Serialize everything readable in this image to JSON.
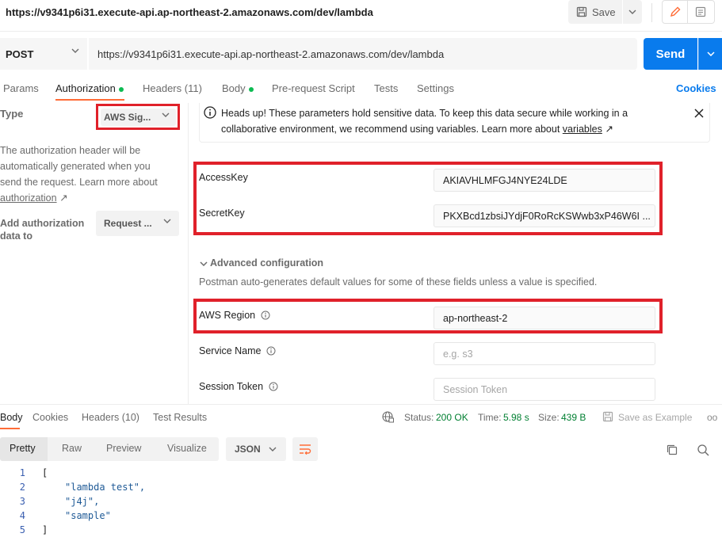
{
  "window": {
    "title": "https://v9341p6i31.execute-api.ap-northeast-2.amazonaws.com/dev/lambda"
  },
  "toolbar": {
    "save_label": "Save"
  },
  "request": {
    "method": "POST",
    "url": "https://v9341p6i31.execute-api.ap-northeast-2.amazonaws.com/dev/lambda",
    "send_label": "Send"
  },
  "tabs": [
    {
      "label": "Params"
    },
    {
      "label": "Authorization"
    },
    {
      "label": "Headers (11)"
    },
    {
      "label": "Body"
    },
    {
      "label": "Pre-request Script"
    },
    {
      "label": "Tests"
    },
    {
      "label": "Settings"
    }
  ],
  "cookies_label": "Cookies",
  "auth": {
    "type_label": "Type",
    "type_value": "AWS Sig...",
    "description": "The authorization header will be automatically generated when you send the request. Learn more about",
    "description_link": "authorization",
    "add_label": "Add authorization data to",
    "add_value": "Request ..."
  },
  "banner": {
    "text": "Heads up! These parameters hold sensitive data. To keep this data secure while working in a collaborative environment, we recommend using variables. Learn more about",
    "link": "variables"
  },
  "fields": {
    "access_key_label": "AccessKey",
    "access_key_value": "AKIAVHLMFGJ4NYE24LDE",
    "secret_key_label": "SecretKey",
    "secret_key_value": "PKXBcd1zbsiJYdjF0RoRcKSWwb3xP46W6I ...",
    "advanced_title": "Advanced configuration",
    "advanced_desc": "Postman auto-generates default values for some of these fields unless a value is specified.",
    "region_label": "AWS Region",
    "region_value": "ap-northeast-2",
    "service_label": "Service Name",
    "service_placeholder": "e.g. s3",
    "session_label": "Session Token",
    "session_placeholder": "Session Token"
  },
  "response": {
    "tabs": [
      {
        "label": "Body"
      },
      {
        "label": "Cookies"
      },
      {
        "label": "Headers (10)"
      },
      {
        "label": "Test Results"
      }
    ],
    "status_label": "Status:",
    "status_value": "200 OK",
    "time_label": "Time:",
    "time_value": "5.98 s",
    "size_label": "Size:",
    "size_value": "439 B",
    "save_example": "Save as Example",
    "more": "oo",
    "view_tabs": [
      {
        "label": "Pretty"
      },
      {
        "label": "Raw"
      },
      {
        "label": "Preview"
      },
      {
        "label": "Visualize"
      }
    ],
    "format": "JSON",
    "code_lines": [
      {
        "n": "1",
        "text": "["
      },
      {
        "n": "2",
        "text": "\"lambda test\","
      },
      {
        "n": "3",
        "text": "\"j4j\","
      },
      {
        "n": "4",
        "text": "\"sample\""
      },
      {
        "n": "5",
        "text": "]"
      }
    ]
  },
  "colors": {
    "accent": "#097bed",
    "tab_underline": "#ff6c37",
    "highlight_red": "#e0212a",
    "status_green": "#007f31"
  }
}
